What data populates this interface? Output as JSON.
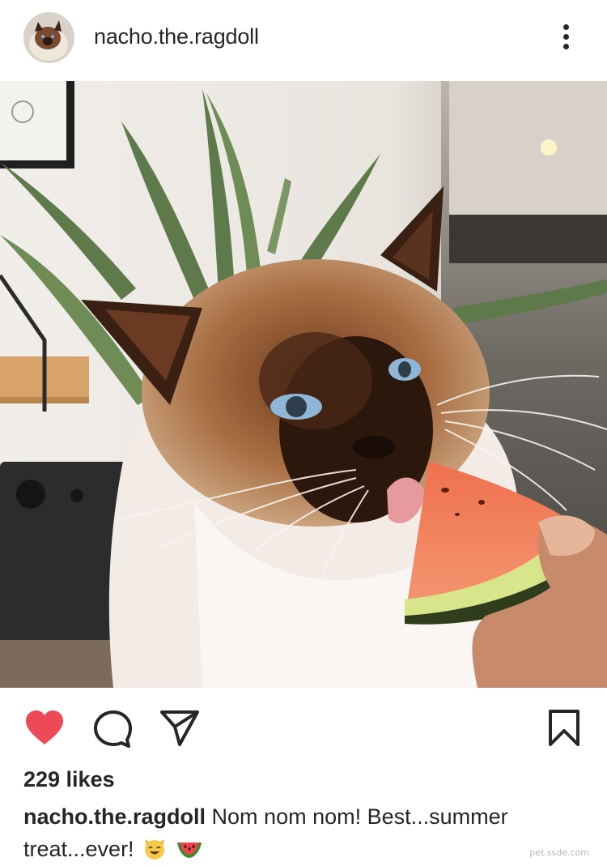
{
  "post": {
    "username": "nacho.the.ragdoll",
    "likes": "229 likes",
    "caption_user": "nacho.the.ragdoll",
    "caption_text": "Nom nom nom! Best...summer treat...ever!",
    "caption_emojis": [
      "smiling-cat-emoji",
      "watermelon-emoji"
    ],
    "liked": true
  },
  "icons": {
    "more": "more-vertical-icon",
    "like": "heart-icon",
    "comment": "comment-icon",
    "share": "send-icon",
    "save": "bookmark-icon"
  },
  "colors": {
    "like_red": "#ed4956",
    "text": "#262626"
  },
  "watermark": "pet.ssde.com"
}
